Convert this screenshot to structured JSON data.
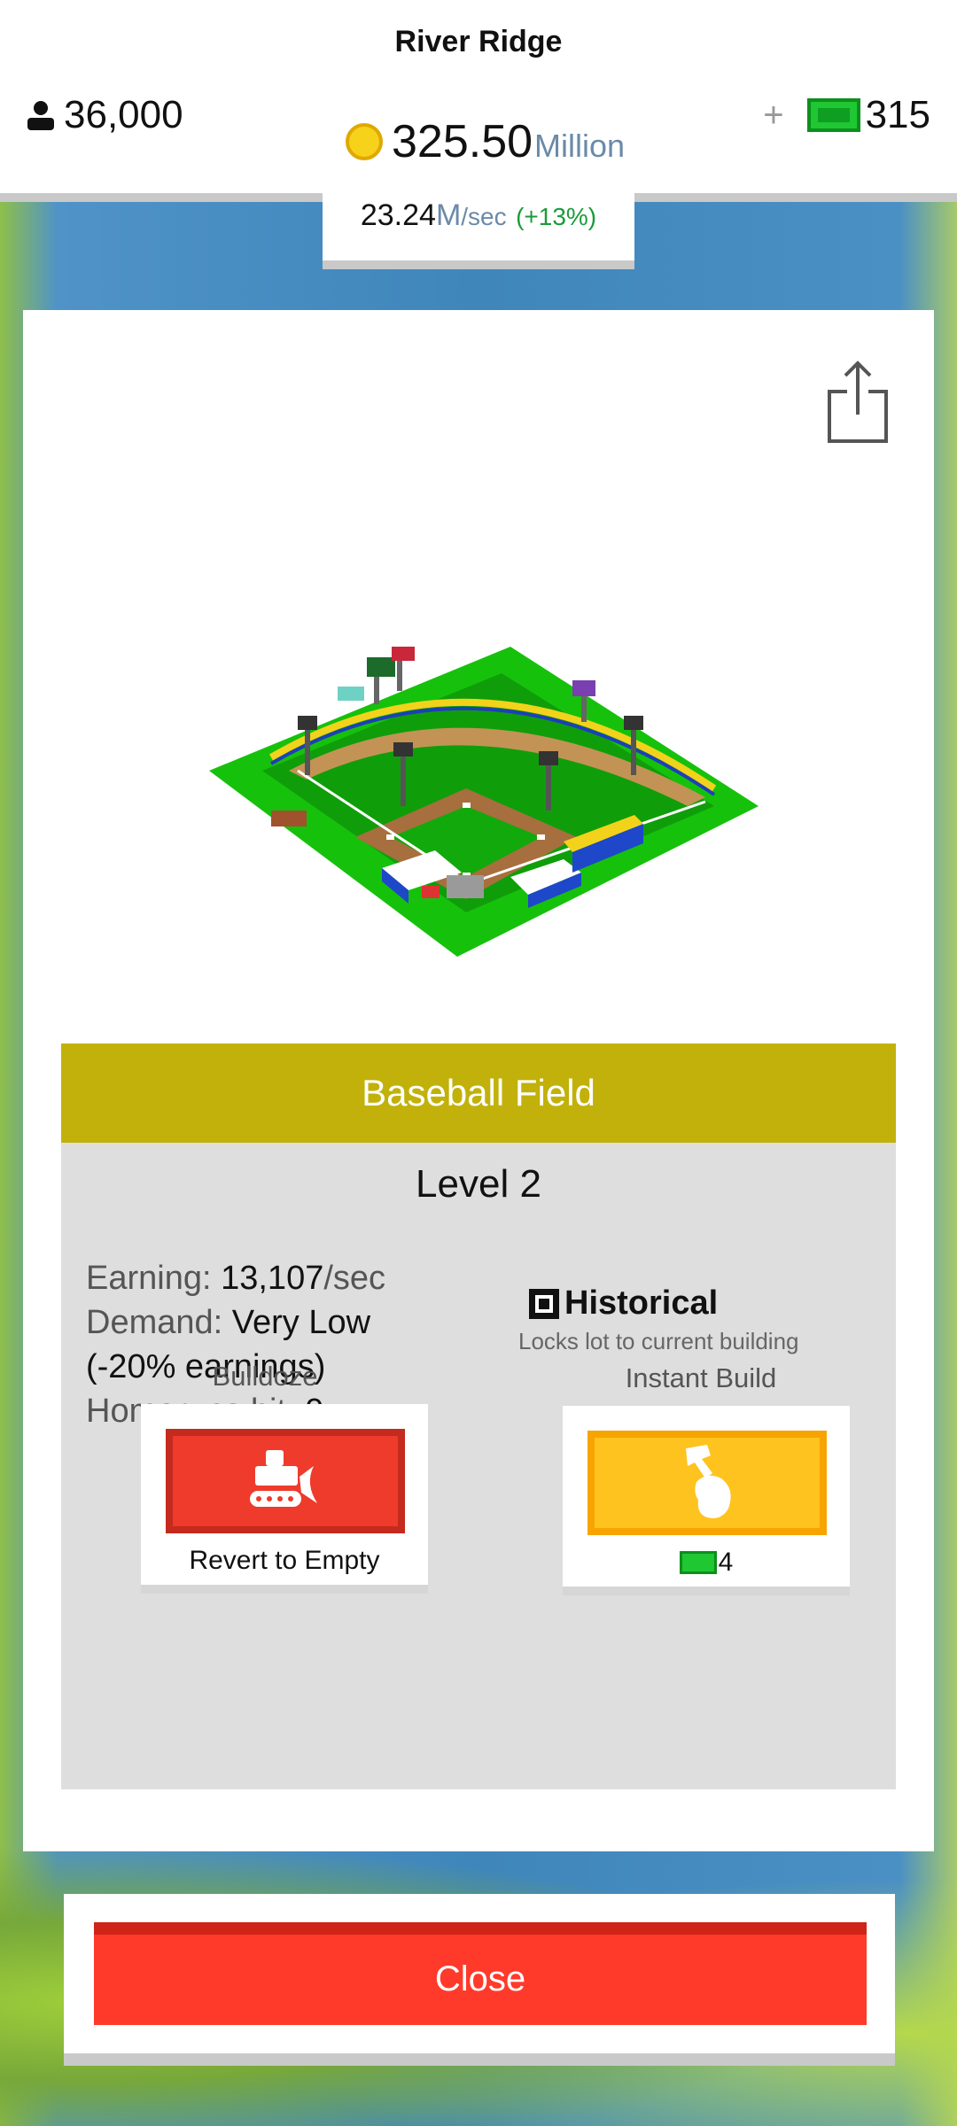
{
  "hud": {
    "town_name": "River Ridge",
    "population": "36,000",
    "money_value": "325.50",
    "money_unit": "Million",
    "cash_plus": "+",
    "cash_value": "315",
    "rate_value": "23.24",
    "rate_unit_m": "M",
    "rate_unit_sec": "/sec",
    "rate_change": "(+13%)"
  },
  "building": {
    "name": "Baseball Field",
    "level": "Level 2",
    "earning_label": "Earning:",
    "earning_value": "13,107",
    "earning_unit": "/sec",
    "demand_label": "Demand:",
    "demand_value": "Very Low (-20% earnings)",
    "homeruns_label": "Homeruns hit:",
    "homeruns_value": "0",
    "historical_label": "Historical",
    "historical_desc": "Locks lot to current building"
  },
  "actions": {
    "bulldoze_label": "Bulldoze",
    "bulldoze_caption": "Revert to Empty",
    "instant_label": "Instant Build",
    "instant_cost": "4"
  },
  "close_label": "Close",
  "icons": {
    "population": "person-icon",
    "money": "coin-icon",
    "cash": "cash-bill-icon",
    "share": "share-icon",
    "bulldoze": "bulldozer-icon",
    "instant": "hammer-icon"
  },
  "colors": {
    "title_bar": "#c2b10a",
    "bulldoze": "#ee3b2c",
    "instant": "#ffc31f",
    "close": "#ff3a2a",
    "rate_change": "#1a9c3a"
  }
}
